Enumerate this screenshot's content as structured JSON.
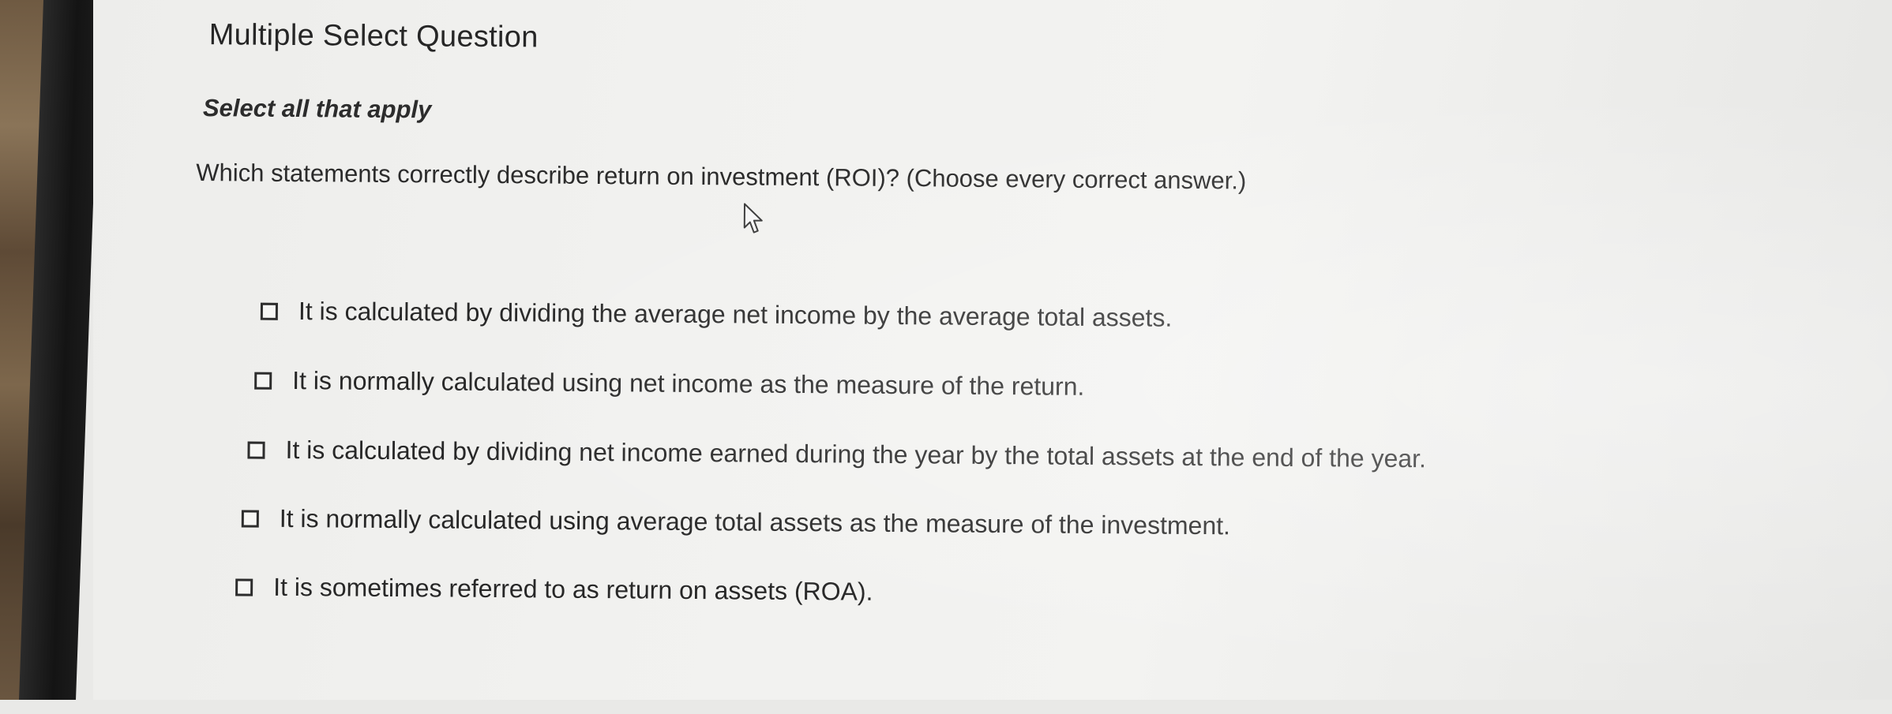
{
  "question": {
    "type_label": "Multiple Select Question",
    "instruction": "Select all that apply",
    "prompt": "Which statements correctly describe return on investment (ROI)? (Choose every correct answer.)"
  },
  "options": [
    {
      "label": "It is calculated by dividing the average net income by the average total assets.",
      "checked": false
    },
    {
      "label": "It is normally calculated using net income as the measure of the return.",
      "checked": false
    },
    {
      "label": "It is calculated by dividing net income earned during the year by the total assets at the end of the year.",
      "checked": false
    },
    {
      "label": "It is normally calculated using average total assets as the measure of the investment.",
      "checked": false
    },
    {
      "label": "It is sometimes referred to as return on assets (ROA).",
      "checked": false
    }
  ],
  "icons": {
    "cursor": "mouse-pointer-icon",
    "checkbox": "checkbox-unchecked-icon"
  }
}
